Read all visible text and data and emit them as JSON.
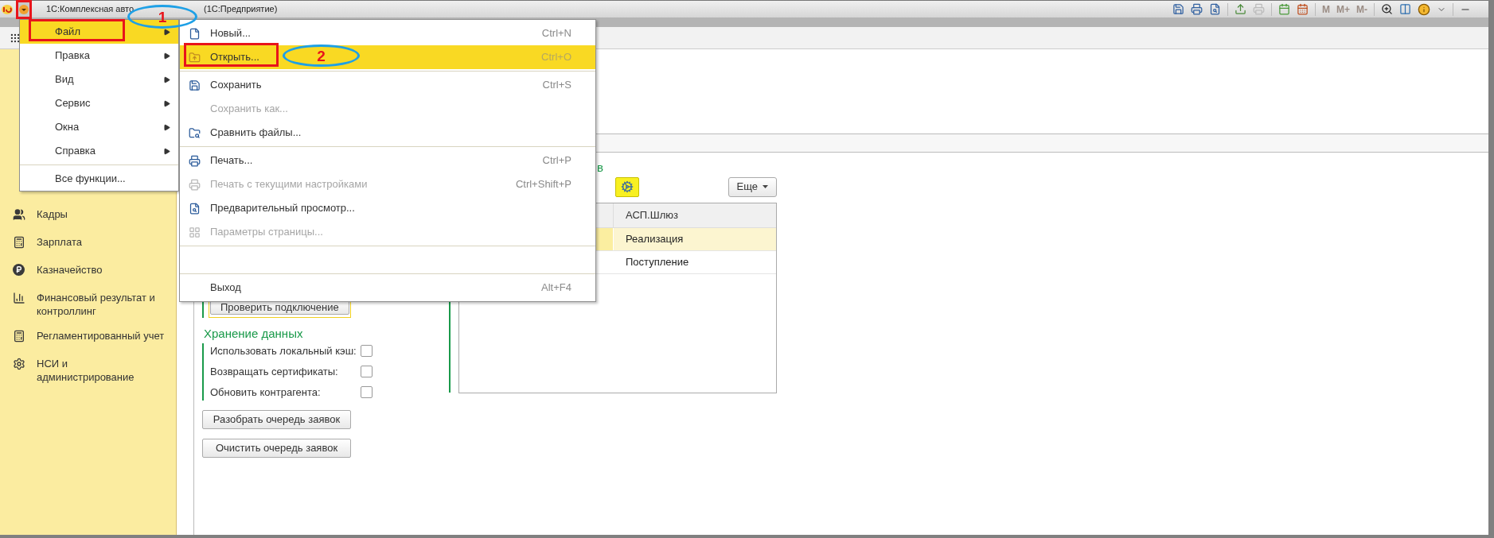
{
  "title_bar": {
    "title_start": "1С:Комплексная авто",
    "title_end": "(1С:Предприятие)",
    "memory_buttons": [
      {
        "label": "M",
        "disabled": true
      },
      {
        "label": "M+",
        "disabled": true
      },
      {
        "label": "M-",
        "disabled": true
      }
    ]
  },
  "main_menu": {
    "items": [
      {
        "label": "Файл",
        "selected": true,
        "submenu": true
      },
      {
        "label": "Правка",
        "selected": false,
        "submenu": true
      },
      {
        "label": "Вид",
        "selected": false,
        "submenu": true
      },
      {
        "label": "Сервис",
        "selected": false,
        "submenu": true
      },
      {
        "label": "Окна",
        "selected": false,
        "submenu": true
      },
      {
        "label": "Справка",
        "selected": false,
        "submenu": true
      },
      {
        "kind": "separator"
      },
      {
        "label": "Все функции...",
        "selected": false,
        "submenu": false
      }
    ]
  },
  "file_menu": {
    "items": [
      {
        "kind": "item",
        "label": "Новый...",
        "shortcut": "Ctrl+N",
        "selected": false,
        "disabled": false
      },
      {
        "kind": "item",
        "label": "Открыть...",
        "shortcut": "Ctrl+O",
        "selected": true,
        "disabled": false
      },
      {
        "kind": "separator"
      },
      {
        "kind": "item",
        "label": "Сохранить",
        "shortcut": "Ctrl+S",
        "selected": false,
        "disabled": false
      },
      {
        "kind": "item",
        "label": "Сохранить как...",
        "selected": false,
        "disabled": true
      },
      {
        "kind": "item",
        "label": "Сравнить файлы...",
        "selected": false,
        "disabled": false
      },
      {
        "kind": "separator"
      },
      {
        "kind": "item",
        "label": "Печать...",
        "shortcut": "Ctrl+P",
        "selected": false,
        "disabled": false
      },
      {
        "kind": "item",
        "label": "Печать с текущими настройками",
        "shortcut": "Ctrl+Shift+P",
        "selected": false,
        "disabled": true
      },
      {
        "kind": "item",
        "label": "Предварительный просмотр...",
        "selected": false,
        "disabled": false
      },
      {
        "kind": "item",
        "label": "Параметры страницы...",
        "selected": false,
        "disabled": true
      },
      {
        "kind": "separator"
      },
      {
        "kind": "blank"
      },
      {
        "kind": "separator"
      },
      {
        "kind": "item",
        "label": "Выход",
        "shortcut": "Alt+F4",
        "selected": false,
        "disabled": false
      }
    ]
  },
  "sidebar": {
    "items": [
      {
        "label": "Кадры"
      },
      {
        "label": "Зарплата"
      },
      {
        "label": "Казначейство"
      },
      {
        "label": "Финансовый результат и контроллинг"
      },
      {
        "label": "Регламентированный учет"
      },
      {
        "label": "НСИ и администрирование"
      }
    ]
  },
  "form": {
    "heading_fragment": "в",
    "more_button": "Еще",
    "table": {
      "columns": [
        "АСП.Шлюз"
      ],
      "rows": [
        {
          "cells": [
            "Реализация"
          ],
          "selected": true
        },
        {
          "cells": [
            "Поступление"
          ],
          "selected": false
        }
      ]
    },
    "check_button": "Проверить подключение",
    "storage": {
      "heading": "Хранение данных",
      "options": [
        {
          "label": "Использовать локальный кэш:",
          "checked": false
        },
        {
          "label": "Возвращать сертификаты:",
          "checked": false
        },
        {
          "label": "Обновить контрагента:",
          "checked": false
        }
      ]
    },
    "buttons": [
      "Разобрать очередь заявок",
      "Очистить очередь заявок"
    ]
  },
  "annotations": [
    {
      "kind": "box"
    },
    {
      "kind": "box"
    },
    {
      "kind": "ellipse",
      "label": "1"
    },
    {
      "kind": "box"
    },
    {
      "kind": "ellipse",
      "label": "2"
    }
  ]
}
